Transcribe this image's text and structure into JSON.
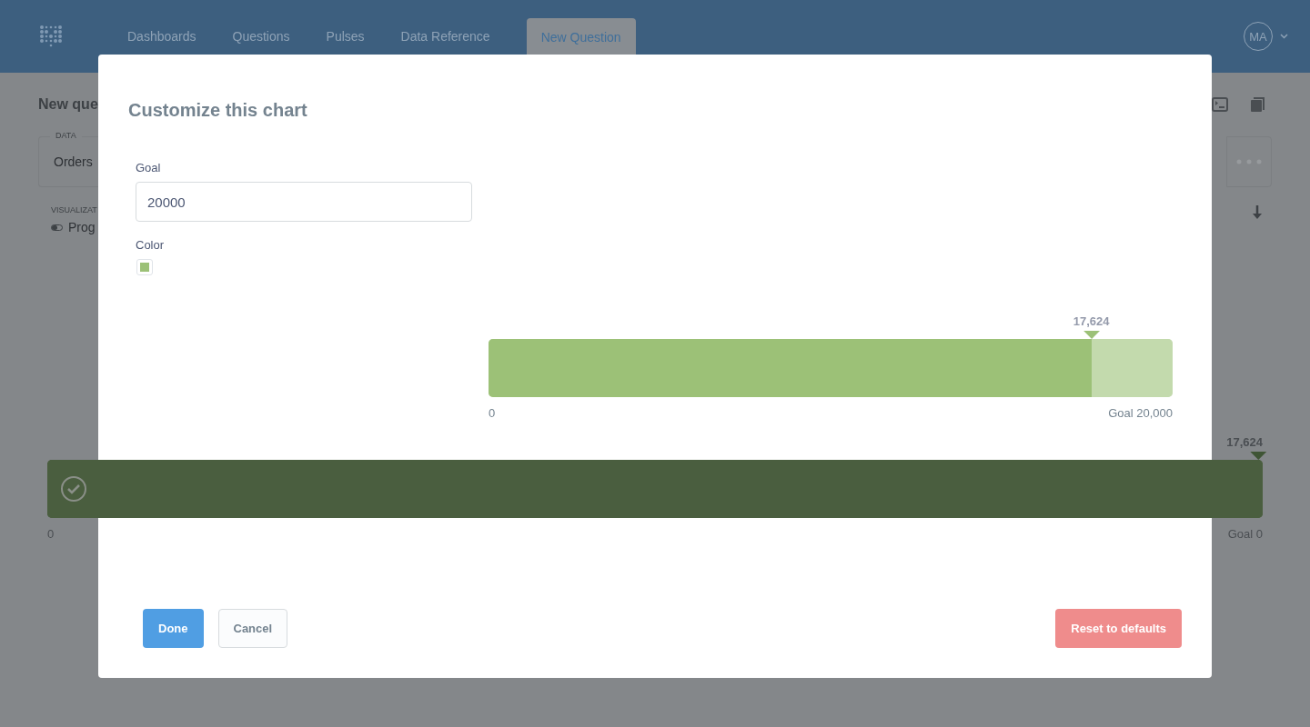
{
  "nav": {
    "items": [
      {
        "label": "Dashboards",
        "selected": false
      },
      {
        "label": "Questions",
        "selected": false
      },
      {
        "label": "Pulses",
        "selected": false
      },
      {
        "label": "Data Reference",
        "selected": false
      },
      {
        "label": "New Question",
        "selected": true
      }
    ],
    "user_initials": "MA"
  },
  "question": {
    "title": "New que",
    "data_legend": "DATA",
    "data_source": "Orders",
    "visualization_label": "VISUALIZAT",
    "visualization_type": "Prog",
    "progress": {
      "level": 1,
      "value_label": "17,624",
      "min_label": "0",
      "goal_label": "Goal 0"
    }
  },
  "modal": {
    "title": "Customize this chart",
    "goal": {
      "label": "Goal",
      "value": "20000"
    },
    "color": {
      "label": "Color",
      "color": "#9cc177"
    },
    "preview": {
      "level": 0.8812,
      "value_label": "17,624",
      "min_label": "0",
      "goal_label": "Goal 20,000"
    },
    "buttons": [
      {
        "label": "Done",
        "kind": "primary"
      },
      {
        "label": "Cancel",
        "kind": "secondary"
      },
      {
        "label": "Reset to defaults",
        "kind": "danger"
      }
    ]
  }
}
